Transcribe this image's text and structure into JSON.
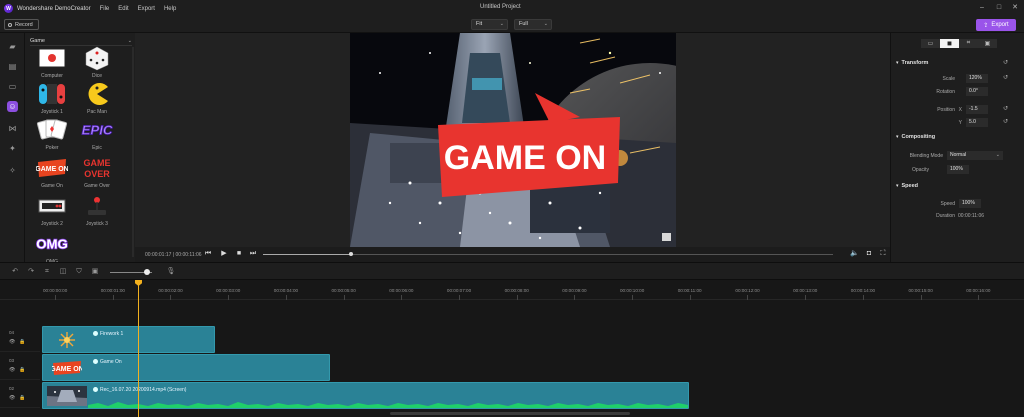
{
  "app": {
    "name": "Wondershare DemoCreator",
    "window_title": "Untitled Project",
    "menu": [
      "File",
      "Edit",
      "Export",
      "Help"
    ]
  },
  "toolbar": {
    "record_label": "Record",
    "fit_value": "Fit",
    "quality_value": "Full",
    "export_label": "Export"
  },
  "library": {
    "category": "Game",
    "stickers": [
      "Computer",
      "Dice",
      "Joystick 1",
      "Pac Man",
      "Poker",
      "Epic",
      "Game On",
      "Game Over",
      "Joystick 2",
      "Joystick 3",
      "OMG"
    ]
  },
  "preview": {
    "current_time": "00:00:01:17",
    "total_time": "00:00:11:06",
    "overlay_text": "GAME ON",
    "progress_fraction": 0.155
  },
  "properties": {
    "transform_title": "Transform",
    "scale_label": "Scale",
    "scale_value": "120%",
    "rotation_label": "Rotation",
    "rotation_value": "0.0°",
    "position_label": "Position",
    "x_label": "X",
    "x_value": "-1.5",
    "y_label": "Y",
    "y_value": "5.0",
    "compositing_title": "Compositing",
    "blending_label": "Blending Mode",
    "blending_value": "Normal",
    "opacity_label": "Opacity",
    "opacity_value": "100%",
    "speed_title": "Speed",
    "speed_label": "Speed",
    "speed_value": "100%",
    "duration_label": "Duration",
    "duration_value": "00:00:11:06"
  },
  "timeline": {
    "ticks": [
      "00:00:00:00",
      "00:00:01:00",
      "00:00:02:00",
      "00:00:03:00",
      "00:00:04:00",
      "00:00:05:00",
      "00:00:06:00",
      "00:00:07:00",
      "00:00:08:00",
      "00:00:09:00",
      "00:00:10:00",
      "00:00:11:00",
      "00:00:12:00",
      "00:00:13:00",
      "00:00:14:00",
      "00:00:15:00",
      "00:00:16:00"
    ],
    "tracks": [
      {
        "number": "04",
        "clip": "Firework 1"
      },
      {
        "number": "03",
        "clip": "Game On"
      },
      {
        "number": "02",
        "clip": "Rec_16.07.20 20200914.mp4 (Screen)"
      }
    ]
  }
}
